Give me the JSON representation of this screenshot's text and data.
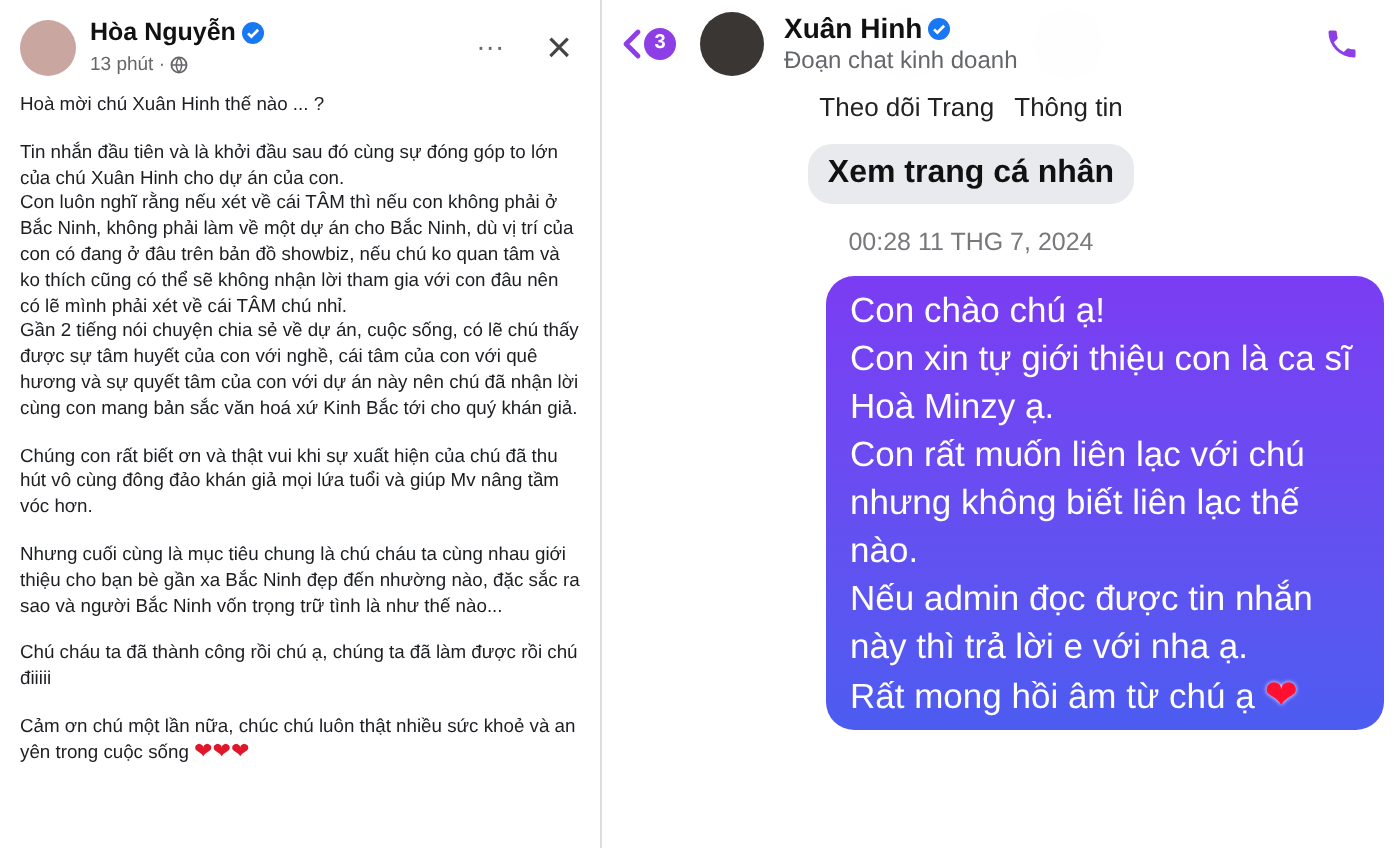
{
  "post": {
    "author": "Hòa Nguyễn",
    "verified": true,
    "time": "13 phút ·",
    "more": "···",
    "close": "×",
    "body": [
      [
        {
          "text": "Hoà mời chú Xuân Hinh thế nào ... ?"
        }
      ],
      [
        {
          "text": "Tin nhắn đầu tiên và là khởi đầu sau đó cùng sự đóng góp to lớn của chú Xuân Hinh cho dự án của con."
        },
        {
          "text": "Con luôn nghĩ rằng nếu xét về cái TÂM thì nếu con không phải ở Bắc Ninh, không phải làm về một dự án cho Bắc Ninh, dù vị trí của con có đang ở đâu trên bản đồ showbiz, nếu chú ko quan tâm và ko thích cũng có thể sẽ không nhận lời tham gia với con đâu nên có lẽ mình phải xét về cái TÂM chú nhỉ."
        },
        {
          "text": "Gần 2 tiếng nói chuyện chia sẻ về dự án, cuộc sống, có lẽ chú thấy được sự tâm huyết của con với nghề, cái tâm của con với quê hương và sự quyết tâm của con với dự án này nên chú đã nhận lời cùng con mang bản sắc văn hoá xứ Kinh Bắc tới cho quý khán giả."
        }
      ],
      [
        {
          "text": "Chúng con rất biết ơn và thật vui khi sự xuất hiện của chú đã thu hút vô cùng đông đảo khán giả mọi lứa tuổi và giúp Mv nâng tầm vóc hơn."
        }
      ],
      [
        {
          "text": "Nhưng cuối cùng là mục tiêu chung là chú cháu ta cùng nhau giới thiệu cho bạn bè gần xa Bắc Ninh đẹp đến nhường nào, đặc sắc ra sao và người Bắc Ninh vốn trọng trữ tình là như thế nào..."
        }
      ],
      [
        {
          "text": "Chú cháu ta đã thành công rồi chú ạ, chúng ta đã làm được rồi chú điiiii"
        }
      ],
      [
        {
          "text": "Cảm ơn chú một lần nữa, chúc chú luôn thật nhiều sức khoẻ và an yên trong cuộc sống",
          "emoji": "❤❤❤"
        }
      ]
    ]
  },
  "chat": {
    "unread_badge": "3",
    "name": "Xuân Hinh",
    "verified": true,
    "subtitle": "Đoạn chat kinh doanh",
    "actions": [
      {
        "label": "Theo dõi Trang"
      },
      {
        "label": "Thông tin"
      }
    ],
    "profile_button": "Xem trang cá nhân",
    "timestamp": "00:28 11 THG 7, 2024",
    "messages": [
      {
        "text": "Con chào chú ạ!\nCon xin tự giới thiệu con là ca sĩ Hoà Minzy ạ.\nCon rất muốn liên lạc với chú nhưng không biết liên lạc thế nào.\nNếu admin đọc được tin nhắn này thì trả lời e với nha ạ.\nRất mong hồi âm từ chú ạ",
        "emoji": "❤"
      }
    ]
  }
}
